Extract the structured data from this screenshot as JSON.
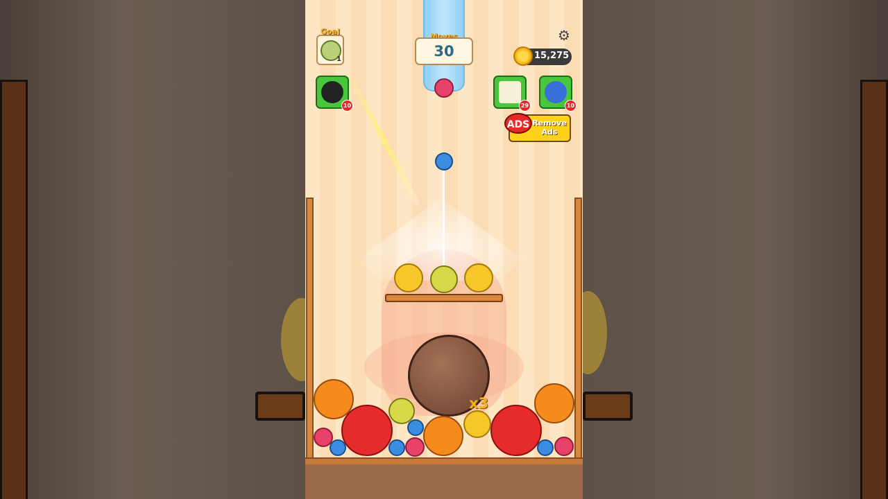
{
  "hud": {
    "goal_label": "Goal",
    "goal_count": "1",
    "goal_icon": "melon-icon",
    "moves_label": "Moves",
    "moves_value": "30",
    "coins": "15,275",
    "settings_icon": "gear-icon"
  },
  "boosters": [
    {
      "name": "bomb",
      "icon": "bomb-icon",
      "count": "10"
    },
    {
      "name": "shake",
      "icon": "shake-phone-icon",
      "count": "29"
    },
    {
      "name": "hammer",
      "icon": "hammer-icon",
      "count": "10"
    }
  ],
  "remove_ads": {
    "tag": "ADS",
    "label_line1": "Remove",
    "label_line2": "Ads"
  },
  "combo_text": "x3",
  "colors": {
    "accent_gold": "#f3b020",
    "booster_green": "#48c73c",
    "badge_red": "#e52828",
    "remove_ads_yellow": "#ffd21a"
  }
}
